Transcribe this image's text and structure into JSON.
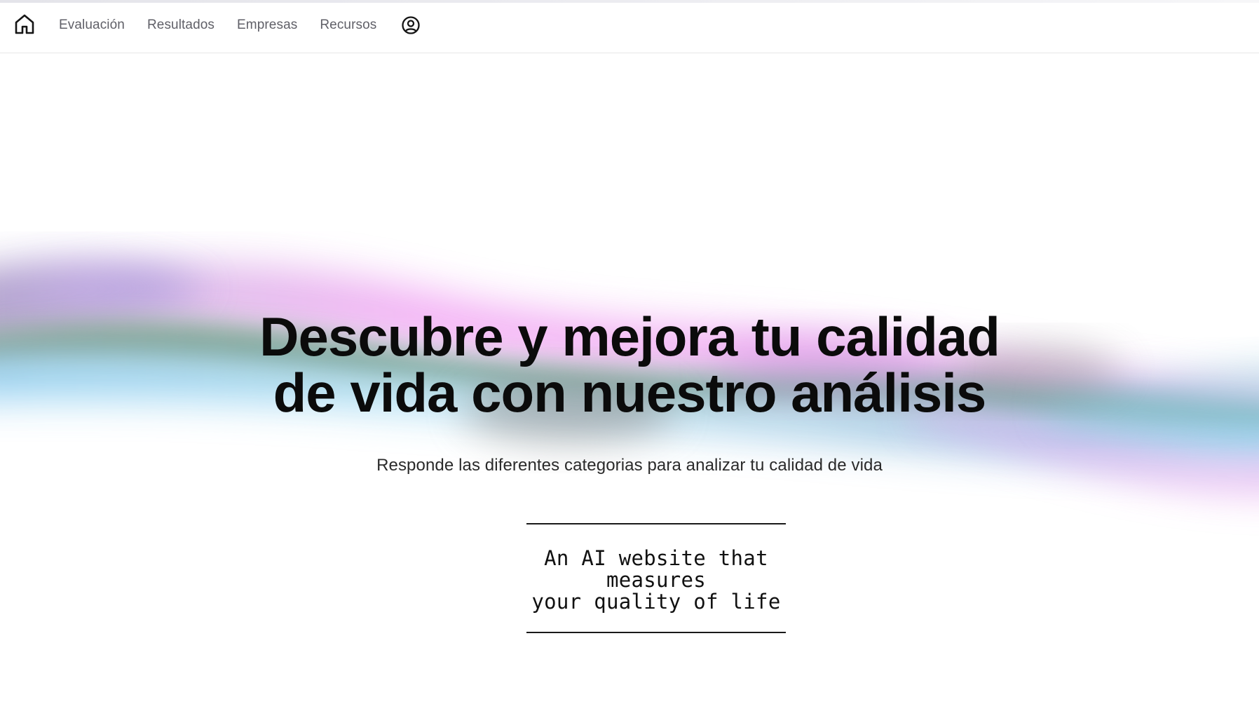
{
  "nav": {
    "home_icon": "home-icon",
    "links": [
      "Evaluación",
      "Resultados",
      "Empresas",
      "Recursos"
    ],
    "profile_icon": "user-circle-icon"
  },
  "hero": {
    "title_line1": "Descubre y mejora tu calidad",
    "title_line2": "de vida con nuestro análisis",
    "subtitle": "Responde las diferentes categorias para analizar tu calidad de vida"
  },
  "tagline": {
    "line1": "An AI website that measures",
    "line2": "your quality of life"
  },
  "colors": {
    "text_primary": "#0b0b0b",
    "nav_text": "#606068",
    "wave_pink": "#ee9af0",
    "wave_blue": "#9dd6ee",
    "wave_green": "#5f8f79",
    "wave_purple": "#9b8cd6",
    "wave_gray": "#9a9a9a"
  }
}
